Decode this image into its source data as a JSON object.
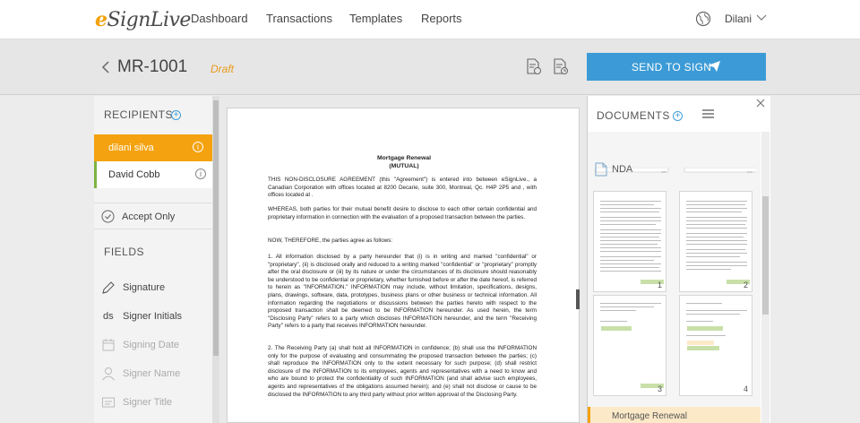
{
  "nav": {
    "logo_e": "e",
    "logo_rest": "SignLive",
    "items": [
      "Dashboard",
      "Transactions",
      "Templates",
      "Reports"
    ],
    "user": "Dilani"
  },
  "transaction": {
    "title": "MR-1001",
    "status": "Draft",
    "send_label": "SEND TO SIGN"
  },
  "recipients": {
    "heading": "RECIPIENTS",
    "list": [
      {
        "name": "dilani silva"
      },
      {
        "name": "David Cobb"
      }
    ],
    "accept_only": "Accept Only"
  },
  "fields": {
    "heading": "FIELDS",
    "items": [
      {
        "label": "Signature"
      },
      {
        "label": "Signer Initials",
        "prefix": "ds"
      },
      {
        "label": "Signing Date"
      },
      {
        "label": "Signer Name"
      },
      {
        "label": "Signer Title"
      }
    ]
  },
  "document": {
    "title": "Mortgage Renewal",
    "subtitle": "(MUTUAL)",
    "paragraphs": [
      "THIS NON-DISCLOSURE AGREEMENT (this \"Agreement\") is entered into between eSignLive., a Canadian Corporation with offices located at 8200 Decarie, suite 300, Montreal, Qc. H4P 2P5 and , with offices located at .",
      "WHEREAS, both parties for their mutual benefit desire to disclose to each other certain confidential and proprietary information in connection with the evaluation of a proposed transaction between the parties.",
      "NOW, THEREFORE, the parties agree as follows:",
      "1. All information disclosed by a party hereunder that (i) is in writing and marked \"confidential\" or \"proprietary\", (ii) is disclosed orally and reduced to a writing marked \"confidential\" or \"proprietary\" promptly after the oral disclosure or (iii) by its nature or under the circumstances of its disclosure should reasonably be understood to be confidential or proprietary, whether furnished before or after the date hereof, is referred to herein as \"INFORMATION.\" INFORMATION may include, without limitation, specifications, designs, plans, drawings, software, data, prototypes, business plans or other business or technical information. All information regarding the negotiations or discussions between the parties hereto with respect to the proposed transaction shall be deemed to be INFORMATION hereunder. As used herein, the term \"Disclosing Party\" refers to a party which discloses INFORMATION hereunder, and the term \"Receiving Party\" refers to a party that receives INFORMATION hereunder.",
      "2. The Receiving Party (a) shall hold all INFORMATION in confidence; (b) shall use the INFORMATION only for the purpose of evaluating and consummating the proposed transaction between the parties; (c) shall reproduce the INFORMATION only to the extent necessary for such purpose; (d) shall restrict disclosure of the INFORMATION to its employees, agents and representatives with a need to know and who are bound to protect the confidentiality of such INFORMATION (and shall advise such employees, agents and representatives of the obligations assumed herein); and (e) shall not disclose or cause to be disclosed the INFORMATION to any third party without prior written approval of the Disclosing Party."
    ]
  },
  "documents_panel": {
    "heading": "DOCUMENTS",
    "current_doc": "NDA",
    "pages": [
      "1",
      "2",
      "3",
      "4"
    ],
    "next_doc": "Mortgage Renewal"
  },
  "colors": {
    "accent_orange": "#f4a20f",
    "accent_blue": "#3c9bd6",
    "status_green": "#7cb342"
  }
}
